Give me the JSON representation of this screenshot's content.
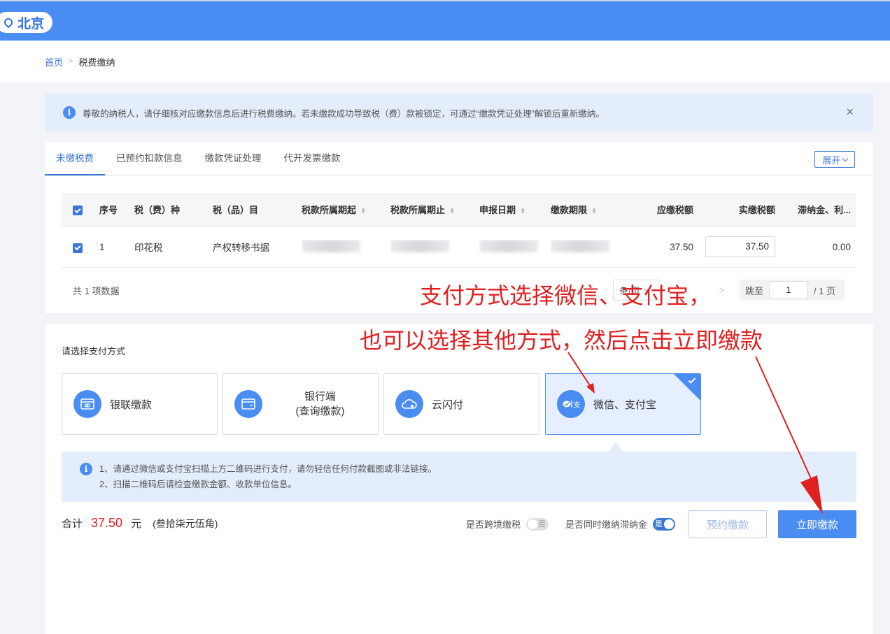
{
  "header": {
    "city": "北京",
    "brand_color": "#4a8df2"
  },
  "breadcrumb": {
    "home": "首页",
    "current": "税费缴纳"
  },
  "notice": {
    "text": "尊敬的纳税人，请仔细核对应缴款信息后进行税费缴纳。若未缴款成功导致税（费）款被锁定，可通过“缴款凭证处理”解锁后重新缴纳。",
    "info_icon": "i",
    "close": "×"
  },
  "tabs": {
    "items": [
      {
        "label": "未缴税费"
      },
      {
        "label": "已预约扣款信息"
      },
      {
        "label": "缴款凭证处理"
      },
      {
        "label": "代开发票缴款"
      }
    ],
    "active": 0,
    "expand": "展开"
  },
  "table": {
    "headers": {
      "no": "序号",
      "type": "税（费）种",
      "item": "税（品）目",
      "start": "税款所属期起",
      "end": "税款所属期止",
      "declare": "申报日期",
      "deadline": "缴款期限",
      "due": "应缴税额",
      "paid": "实缴税额",
      "late": "滞纳金、利..."
    },
    "rows": [
      {
        "no": "1",
        "type": "印花税",
        "item": "产权转移书据",
        "due": "37.50",
        "paid": "37.50",
        "late": "0.00"
      }
    ]
  },
  "pager": {
    "total": "共 1 项数据",
    "page_size": "条/页",
    "jump_label": "跳至",
    "page": "1",
    "page_total": "/ 1 页"
  },
  "payment": {
    "title": "请选择支付方式",
    "options": [
      {
        "label": "银联缴款",
        "icon": "card-icon"
      },
      {
        "label": "银行端",
        "label2": "(查询缴款)",
        "icon": "wallet-icon"
      },
      {
        "label": "云闪付",
        "icon": "cloud-pay-icon"
      },
      {
        "label": "微信、支付宝",
        "icon": "wechat-alipay-icon"
      }
    ],
    "selected": 3,
    "tips": [
      "1、请通过微信或支付宝扫描上方二维码进行支付，请勿轻信任何付款截图或非法链接。",
      "2、扫描二维码后请检查缴款金额、收款单位信息。"
    ]
  },
  "summary": {
    "label": "合计",
    "amount": "37.50",
    "unit": "元",
    "words": "(叁拾柒元伍角)"
  },
  "toggles": {
    "cross_border": {
      "label": "是否跨境缴税",
      "value": "否"
    },
    "late_fee": {
      "label": "是否同时缴纳滞纳金",
      "value": "是"
    }
  },
  "buttons": {
    "appointment": "预约缴款",
    "pay_now": "立即缴款"
  },
  "annotations": {
    "line1": "支付方式选择微信、支付宝，",
    "line2": "也可以选择其他方式，然后点击立即缴款",
    "color": "#e02020"
  }
}
